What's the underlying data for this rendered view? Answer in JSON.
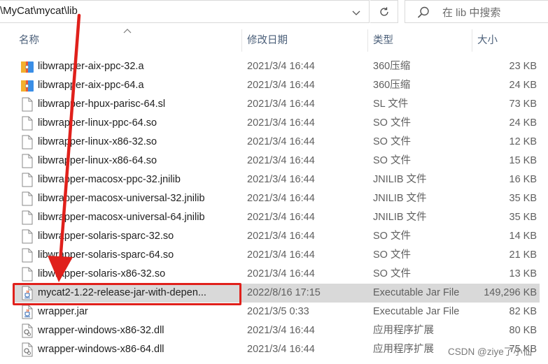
{
  "address_bar": {
    "path": "\\MyCat\\mycat\\lib"
  },
  "search": {
    "placeholder": "在 lib 中搜索"
  },
  "columns": {
    "name": "名称",
    "date": "修改日期",
    "type": "类型",
    "size": "大小"
  },
  "files": [
    {
      "name": "libwrapper-aix-ppc-32.a",
      "date": "2021/3/4 16:44",
      "type": "360压缩",
      "size": "23 KB",
      "icon": "archive-icon"
    },
    {
      "name": "libwrapper-aix-ppc-64.a",
      "date": "2021/3/4 16:44",
      "type": "360压缩",
      "size": "24 KB",
      "icon": "archive-icon"
    },
    {
      "name": "libwrapper-hpux-parisc-64.sl",
      "date": "2021/3/4 16:44",
      "type": "SL 文件",
      "size": "73 KB",
      "icon": "file-icon"
    },
    {
      "name": "libwrapper-linux-ppc-64.so",
      "date": "2021/3/4 16:44",
      "type": "SO 文件",
      "size": "24 KB",
      "icon": "file-icon"
    },
    {
      "name": "libwrapper-linux-x86-32.so",
      "date": "2021/3/4 16:44",
      "type": "SO 文件",
      "size": "12 KB",
      "icon": "file-icon"
    },
    {
      "name": "libwrapper-linux-x86-64.so",
      "date": "2021/3/4 16:44",
      "type": "SO 文件",
      "size": "15 KB",
      "icon": "file-icon"
    },
    {
      "name": "libwrapper-macosx-ppc-32.jnilib",
      "date": "2021/3/4 16:44",
      "type": "JNILIB 文件",
      "size": "16 KB",
      "icon": "file-icon"
    },
    {
      "name": "libwrapper-macosx-universal-32.jnilib",
      "date": "2021/3/4 16:44",
      "type": "JNILIB 文件",
      "size": "35 KB",
      "icon": "file-icon"
    },
    {
      "name": "libwrapper-macosx-universal-64.jnilib",
      "date": "2021/3/4 16:44",
      "type": "JNILIB 文件",
      "size": "35 KB",
      "icon": "file-icon"
    },
    {
      "name": "libwrapper-solaris-sparc-32.so",
      "date": "2021/3/4 16:44",
      "type": "SO 文件",
      "size": "14 KB",
      "icon": "file-icon"
    },
    {
      "name": "libwrapper-solaris-sparc-64.so",
      "date": "2021/3/4 16:44",
      "type": "SO 文件",
      "size": "21 KB",
      "icon": "file-icon"
    },
    {
      "name": "libwrapper-solaris-x86-32.so",
      "date": "2021/3/4 16:44",
      "type": "SO 文件",
      "size": "13 KB",
      "icon": "file-icon"
    },
    {
      "name": "mycat2-1.22-release-jar-with-depen...",
      "date": "2022/8/16 17:15",
      "type": "Executable Jar File",
      "size": "149,296 KB",
      "icon": "jar-icon",
      "selected": true
    },
    {
      "name": "wrapper.jar",
      "date": "2021/3/5 0:33",
      "type": "Executable Jar File",
      "size": "82 KB",
      "icon": "jar-icon"
    },
    {
      "name": "wrapper-windows-x86-32.dll",
      "date": "2021/3/4 16:44",
      "type": "应用程序扩展",
      "size": "80 KB",
      "icon": "dll-icon"
    },
    {
      "name": "wrapper-windows-x86-64.dll",
      "date": "2021/3/4 16:44",
      "type": "应用程序扩展",
      "size": "75 KB",
      "icon": "dll-icon"
    }
  ],
  "watermark": "CSDN @ziye了小仙",
  "colors": {
    "selection": "#d9d9d9",
    "annotation": "#e0201b",
    "header_text": "#4c607a"
  }
}
